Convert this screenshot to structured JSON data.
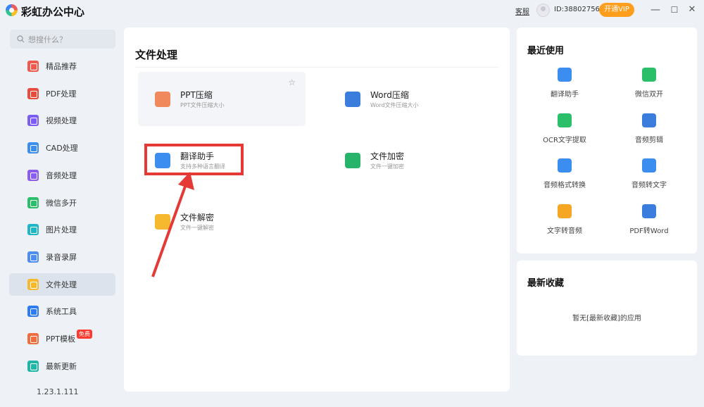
{
  "app": {
    "title": "彩虹办公中心"
  },
  "topbar": {
    "service_link": "客服",
    "user_id": "ID:38802756",
    "vip_label": "开通VIP",
    "minimize": "—",
    "maximize": "☐",
    "close": "✕"
  },
  "search": {
    "placeholder": "想搜什么？"
  },
  "sidebar": {
    "items": [
      {
        "label": "精品推荐",
        "icon": "thumbs-up-icon",
        "color": "#ef5a4e"
      },
      {
        "label": "PDF处理",
        "icon": "pdf-icon",
        "color": "#e74c3c"
      },
      {
        "label": "视频处理",
        "icon": "video-play-icon",
        "color": "#7c5cf2"
      },
      {
        "label": "CAD处理",
        "icon": "cad-icon",
        "color": "#3b8ef0"
      },
      {
        "label": "音频处理",
        "icon": "music-icon",
        "color": "#8a5cf2"
      },
      {
        "label": "微信多开",
        "icon": "wechat-icon",
        "color": "#2bbf6a"
      },
      {
        "label": "图片处理",
        "icon": "image-icon",
        "color": "#20b6c9"
      },
      {
        "label": "录音录屏",
        "icon": "microphone-icon",
        "color": "#4d8ef5"
      },
      {
        "label": "文件处理",
        "icon": "folder-icon",
        "color": "#f5b82e",
        "active": true
      },
      {
        "label": "系统工具",
        "icon": "gear-icon",
        "color": "#2e7cf5"
      },
      {
        "label": "PPT模板",
        "icon": "ppt-icon",
        "color": "#f26d3d",
        "badge": "免费"
      },
      {
        "label": "最新更新",
        "icon": "upload-icon",
        "color": "#1fb5a8"
      }
    ],
    "version": "1.23.1.111"
  },
  "main": {
    "title": "文件处理",
    "tools": [
      {
        "name": "PPT压缩",
        "desc": "PPT文件压缩大小",
        "icon": "ppt-compress-icon",
        "color": "#f08a5d"
      },
      {
        "name": "Word压缩",
        "desc": "Word文件压缩大小",
        "icon": "word-compress-icon",
        "color": "#3b7ddd"
      },
      {
        "name": "翻译助手",
        "desc": "支持多种语言翻译",
        "icon": "translate-icon",
        "color": "#3b8ef0"
      },
      {
        "name": "文件加密",
        "desc": "文件一键加密",
        "icon": "file-lock-icon",
        "color": "#27b36a"
      },
      {
        "name": "文件解密",
        "desc": "文件一键解密",
        "icon": "file-unlock-icon",
        "color": "#f5b82e"
      }
    ]
  },
  "recent": {
    "title": "最近使用",
    "items": [
      {
        "label": "翻译助手",
        "icon": "translate-icon",
        "color": "#3b8ef0"
      },
      {
        "label": "微信双开",
        "icon": "wechat-icon",
        "color": "#2bbf6a"
      },
      {
        "label": "OCR文字提取",
        "icon": "ocr-icon",
        "color": "#2bbf6a"
      },
      {
        "label": "音频剪辑",
        "icon": "audio-cut-icon",
        "color": "#3b7ddd"
      },
      {
        "label": "音频格式转换",
        "icon": "audio-convert-icon",
        "color": "#3b8ef0"
      },
      {
        "label": "音频转文字",
        "icon": "audio-text-icon",
        "color": "#3b8ef0"
      },
      {
        "label": "文字转音频",
        "icon": "text-audio-icon",
        "color": "#f5a623"
      },
      {
        "label": "PDF转Word",
        "icon": "pdf-word-icon",
        "color": "#3b7ddd"
      }
    ]
  },
  "favorites": {
    "title": "最新收藏",
    "empty": "暂无[最新收藏]的应用"
  }
}
